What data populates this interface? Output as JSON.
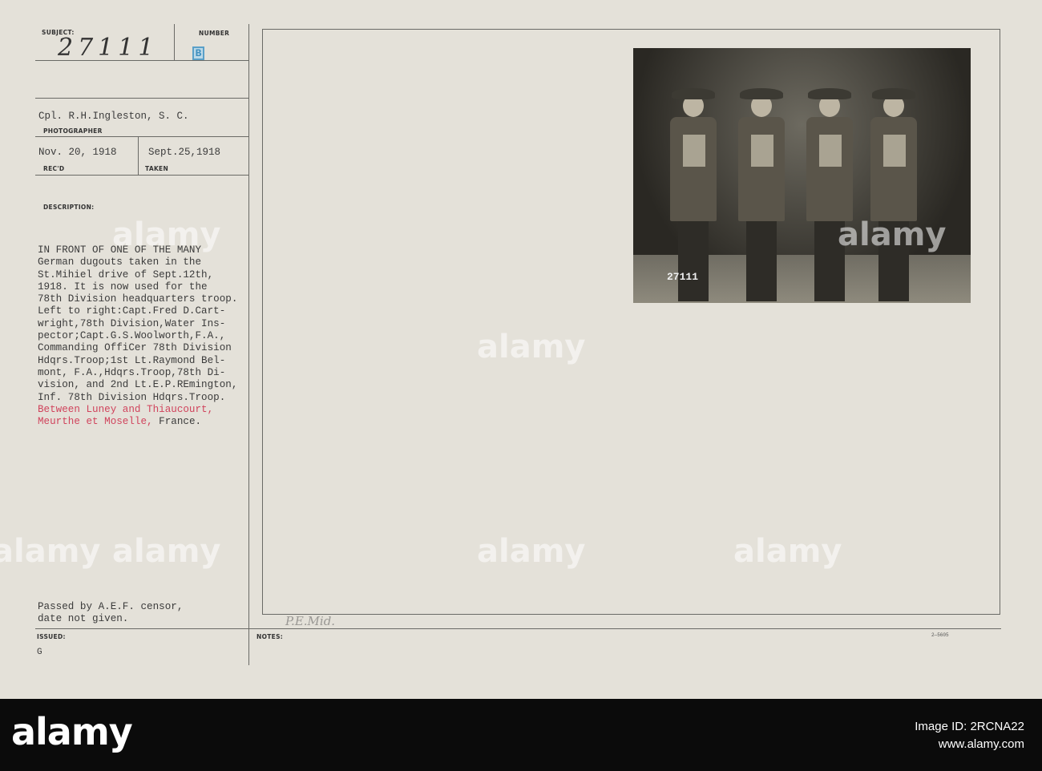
{
  "card": {
    "subject_label": "SUBJECT:",
    "subject_number": "27111",
    "number_label": "NUMBER",
    "number_stamp": "B",
    "photographer": "Cpl. R.H.Ingleston, S. C.",
    "photographer_label": "PHOTOGRAPHER",
    "received": "Nov. 20, 1918",
    "received_label": "REC'D",
    "taken": "Sept.25,1918",
    "taken_label": "TAKEN",
    "description_label": "DESCRIPTION:",
    "description_lines": [
      "IN FRONT OF ONE OF THE MANY",
      "German dugouts taken in the",
      "St.Mihiel drive of Sept.12th,",
      "1918. It is now used for the",
      "78th Division headquarters troop.",
      "Left to right:Capt.Fred D.Cart-",
      "wright,78th Division,Water Ins-",
      "pector;Capt.G.S.Woolworth,F.A.,",
      "Commanding OffiCer 78th Division",
      "Hdqrs.Troop;1st Lt.Raymond Bel-",
      "mont, F.A.,Hdqrs.Troop,78th Di-",
      "vision, and 2nd Lt.E.P.REmington,",
      "Inf. 78th Division Hdqrs.Troop."
    ],
    "location_red_1": "Between Luney and Thiaucourt,",
    "location_red_2": "Meurthe et Moselle,",
    "location_country": " France.",
    "censor_1": "Passed by A.E.F. censor,",
    "censor_2": "date not given.",
    "issued_label": "ISSUED:",
    "issued_value": "G",
    "notes_label": "NOTES:",
    "pencil_note": "P.E.Mid.",
    "form_number": "2—5605",
    "photo_number": "27111"
  },
  "watermark": "alamy",
  "footer": {
    "logo": "alamy",
    "image_id_label": "Image ID: 2RCNA22",
    "site": "www.alamy.com"
  },
  "colors": {
    "paper": "#e4e1d9",
    "red_type": "#d0435c",
    "stamp_blue": "#3f8fbf",
    "footer": "#0b0b0b"
  }
}
